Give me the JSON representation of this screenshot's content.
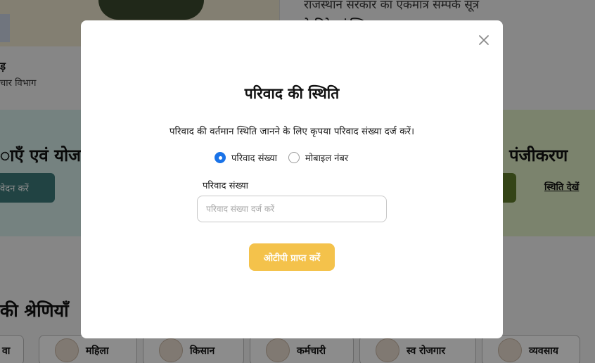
{
  "background": {
    "hero": {
      "person_name": "ड़",
      "person_department": "चार विभाग",
      "tagline": "राजस्थान सरकार का एकमात्र सम्पर्क सूत्र",
      "click_link": "के लिये यहां क्लिक क"
    },
    "band_left": {
      "title": "ाएँ एवं योज",
      "button_label": "वेदन करें"
    },
    "band_right": {
      "title": "पंजीकरण",
      "status_link": "स्थिति देखें"
    },
    "categories": {
      "title": "की श्रेणियाँ",
      "items": [
        {
          "label": "वा",
          "icon": "youth-icon"
        },
        {
          "label": "महिला",
          "icon": "woman-icon"
        },
        {
          "label": "किसान",
          "icon": "farmer-icon"
        },
        {
          "label": "कर्मचारी",
          "icon": "employee-icon"
        },
        {
          "label": "स्व रोजगार",
          "icon": "self-employment-icon"
        },
        {
          "label": "व्यवसाय",
          "icon": "business-icon"
        }
      ]
    }
  },
  "modal": {
    "title": "परिवाद की स्थिति",
    "description": "परिवाद की वर्तमान स्थिति जानने के लिए कृपया परिवाद संख्या दर्ज करें।",
    "radio_options": [
      {
        "label": "परिवाद संख्या",
        "selected": true
      },
      {
        "label": "मोबाइल नंबर",
        "selected": false
      }
    ],
    "field_label": "परिवाद संख्या",
    "field_placeholder": "परिवाद संख्या दर्ज करें",
    "field_value": "",
    "submit_label": "ओटीपी प्राप्त करें",
    "close_icon": "close-icon"
  },
  "colors": {
    "accent_button": "#f4c24b",
    "radio_selected": "#1a73e8",
    "overlay": "rgba(0,0,0,0.45)"
  }
}
